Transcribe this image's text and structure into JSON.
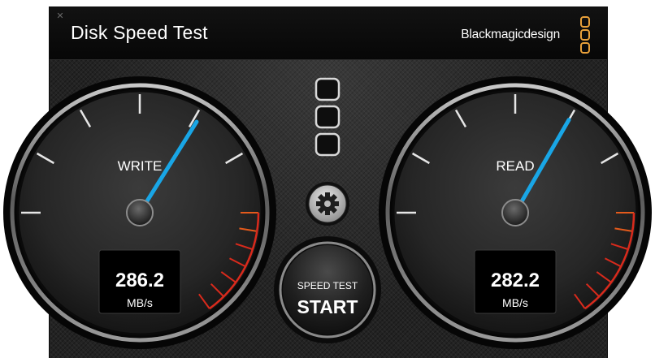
{
  "window": {
    "title": "Disk Speed Test",
    "close_glyph": "✕",
    "brand": "Blackmagicdesign"
  },
  "write_gauge": {
    "label": "WRITE",
    "value": "286.2",
    "unit": "MB/s"
  },
  "read_gauge": {
    "label": "READ",
    "value": "282.2",
    "unit": "MB/s"
  },
  "controls": {
    "target_icon": "stacked-squares-icon",
    "settings_icon": "gear-icon",
    "start_button": {
      "subtitle": "SPEED TEST",
      "label": "START"
    }
  },
  "colors": {
    "needle": "#19a6e6",
    "brand_orange": "#e8a03a",
    "redline": "#d92a1c",
    "redline_orange": "#e35a1c"
  }
}
